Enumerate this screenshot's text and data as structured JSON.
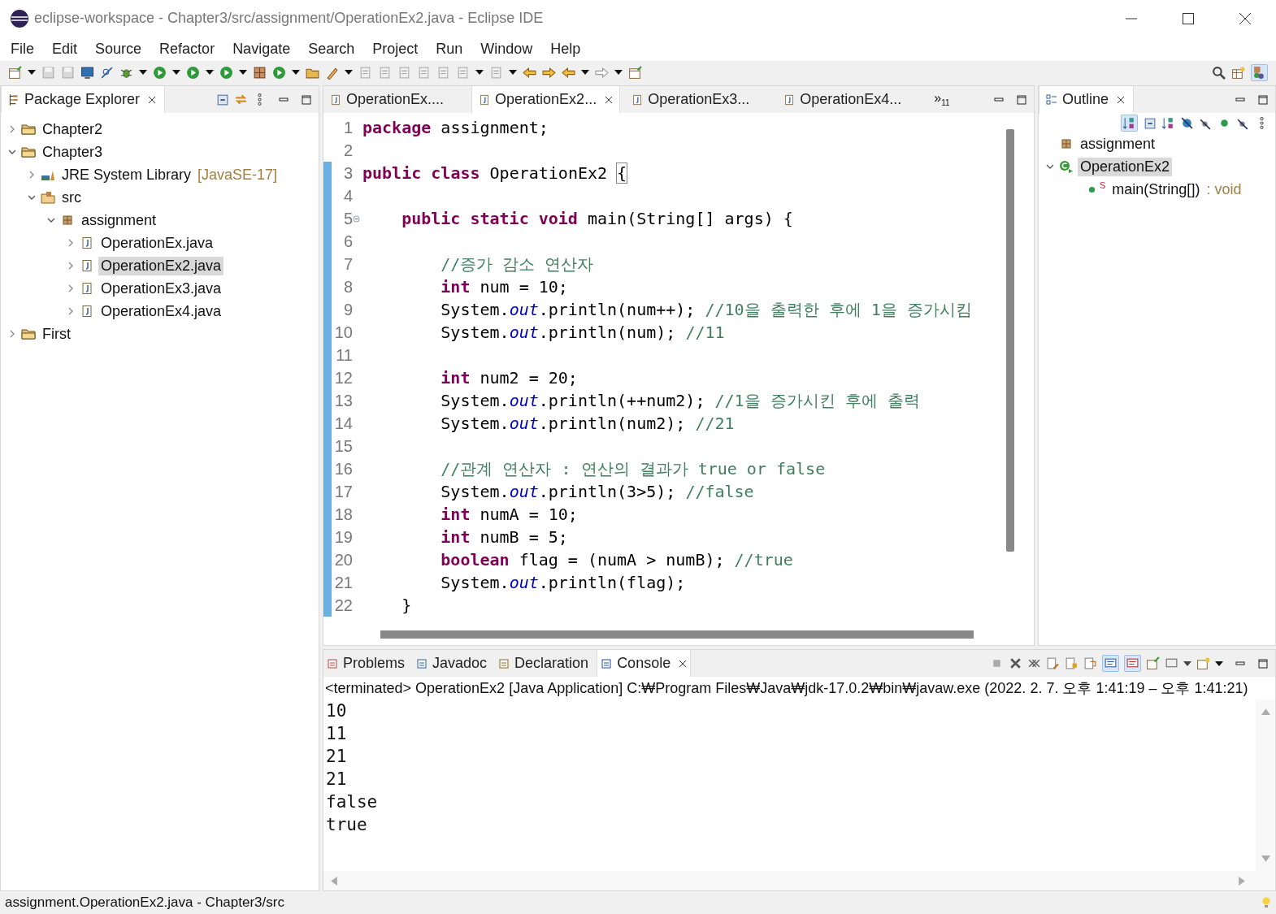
{
  "window": {
    "title": "eclipse-workspace - Chapter3/src/assignment/OperationEx2.java - Eclipse IDE"
  },
  "menu": [
    "File",
    "Edit",
    "Source",
    "Refactor",
    "Navigate",
    "Search",
    "Project",
    "Run",
    "Window",
    "Help"
  ],
  "explorer": {
    "title": "Package Explorer",
    "tree": [
      {
        "label": "Chapter2",
        "kind": "project",
        "expanded": false,
        "selected": false
      },
      {
        "label": "Chapter3",
        "kind": "project",
        "expanded": true,
        "selected": false,
        "children": [
          {
            "label": "JRE System Library",
            "suffix": "[JavaSE-17]",
            "kind": "library",
            "expanded": false,
            "selected": false
          },
          {
            "label": "src",
            "kind": "folder",
            "expanded": true,
            "selected": false,
            "children": [
              {
                "label": "assignment",
                "kind": "package",
                "expanded": true,
                "selected": false,
                "children": [
                  {
                    "label": "OperationEx.java",
                    "kind": "file",
                    "expanded": false,
                    "selected": false
                  },
                  {
                    "label": "OperationEx2.java",
                    "kind": "file",
                    "expanded": false,
                    "selected": true
                  },
                  {
                    "label": "OperationEx3.java",
                    "kind": "file",
                    "expanded": false,
                    "selected": false
                  },
                  {
                    "label": "OperationEx4.java",
                    "kind": "file",
                    "expanded": false,
                    "selected": false
                  }
                ]
              }
            ]
          }
        ]
      },
      {
        "label": "First",
        "kind": "project",
        "expanded": false,
        "selected": false
      }
    ]
  },
  "editor": {
    "tabs": [
      {
        "label": "OperationEx....",
        "selected": false
      },
      {
        "label": "OperationEx2...",
        "selected": true
      },
      {
        "label": "OperationEx3...",
        "selected": false
      },
      {
        "label": "OperationEx4...",
        "selected": false
      }
    ],
    "overflow": {
      "mark": "»",
      "count": "11"
    },
    "lines": [
      {
        "number": "1",
        "changed": false,
        "tokens": [
          {
            "kind": "kw",
            "s": "package"
          },
          {
            "kind": "text",
            "s": " assignment;"
          }
        ]
      },
      {
        "number": "2",
        "changed": false
      },
      {
        "number": "3",
        "changed": true,
        "tokens": [
          {
            "kind": "kw",
            "s": "public "
          },
          {
            "kind": "kw",
            "s": "class"
          },
          {
            "kind": "text",
            "s": " OperationEx2 "
          },
          {
            "kind": "bracket",
            "s": "{"
          }
        ]
      },
      {
        "number": "4",
        "changed": true
      },
      {
        "number": "5",
        "changed": true,
        "expanded": true,
        "tokens": [
          {
            "kind": "kw",
            "s": "    public "
          },
          {
            "kind": "kw",
            "s": "static "
          },
          {
            "kind": "kw",
            "s": "void"
          },
          {
            "kind": "text",
            "s": " main(String[] args) {"
          }
        ]
      },
      {
        "number": "6",
        "changed": true
      },
      {
        "number": "7",
        "changed": true,
        "tokens": [
          {
            "kind": "comment",
            "s": "        //증가 감소 연산자"
          }
        ]
      },
      {
        "number": "8",
        "changed": true,
        "tokens": [
          {
            "kind": "kw",
            "s": "        int"
          },
          {
            "kind": "text",
            "s": " num = 10;"
          }
        ]
      },
      {
        "number": "9",
        "changed": true,
        "tokens": [
          {
            "kind": "text",
            "s": "        System."
          },
          {
            "kind": "field",
            "s": "out"
          },
          {
            "kind": "text",
            "s": ".println(num++); "
          },
          {
            "kind": "comment",
            "s": "//10을 출력한 후에 1을 증가시킴"
          }
        ]
      },
      {
        "number": "10",
        "changed": true,
        "tokens": [
          {
            "kind": "text",
            "s": "        System."
          },
          {
            "kind": "field",
            "s": "out"
          },
          {
            "kind": "text",
            "s": ".println(num); "
          },
          {
            "kind": "comment",
            "s": "//11"
          }
        ]
      },
      {
        "number": "11",
        "changed": true
      },
      {
        "number": "12",
        "changed": true,
        "tokens": [
          {
            "kind": "kw",
            "s": "        int"
          },
          {
            "kind": "text",
            "s": " num2 = 20;"
          }
        ]
      },
      {
        "number": "13",
        "changed": true,
        "tokens": [
          {
            "kind": "text",
            "s": "        System."
          },
          {
            "kind": "field",
            "s": "out"
          },
          {
            "kind": "text",
            "s": ".println(++num2); "
          },
          {
            "kind": "comment",
            "s": "//1을 증가시킨 후에 출력"
          }
        ]
      },
      {
        "number": "14",
        "changed": true,
        "tokens": [
          {
            "kind": "text",
            "s": "        System."
          },
          {
            "kind": "field",
            "s": "out"
          },
          {
            "kind": "text",
            "s": ".println(num2); "
          },
          {
            "kind": "comment",
            "s": "//21"
          }
        ]
      },
      {
        "number": "15",
        "changed": true
      },
      {
        "number": "16",
        "changed": true,
        "tokens": [
          {
            "kind": "comment",
            "s": "        //관계 연산자 : 연산의 결과가 true or false"
          }
        ]
      },
      {
        "number": "17",
        "changed": true,
        "tokens": [
          {
            "kind": "text",
            "s": "        System."
          },
          {
            "kind": "field",
            "s": "out"
          },
          {
            "kind": "text",
            "s": ".println(3>5); "
          },
          {
            "kind": "comment",
            "s": "//false"
          }
        ]
      },
      {
        "number": "18",
        "changed": true,
        "tokens": [
          {
            "kind": "kw",
            "s": "        int"
          },
          {
            "kind": "text",
            "s": " numA = 10;"
          }
        ]
      },
      {
        "number": "19",
        "changed": true,
        "tokens": [
          {
            "kind": "kw",
            "s": "        int"
          },
          {
            "kind": "text",
            "s": " numB = 5;"
          }
        ]
      },
      {
        "number": "20",
        "changed": true,
        "tokens": [
          {
            "kind": "kw",
            "s": "        boolean"
          },
          {
            "kind": "text",
            "s": " flag = (numA > numB); "
          },
          {
            "kind": "comment",
            "s": "//true"
          }
        ]
      },
      {
        "number": "21",
        "changed": true,
        "tokens": [
          {
            "kind": "text",
            "s": "        System."
          },
          {
            "kind": "field",
            "s": "out"
          },
          {
            "kind": "text",
            "s": ".println(flag);"
          }
        ]
      },
      {
        "number": "22",
        "changed": true,
        "tokens": [
          {
            "kind": "text",
            "s": "    }"
          }
        ]
      }
    ]
  },
  "outline": {
    "title": "Outline",
    "tree": [
      {
        "label": "assignment",
        "kind": "package",
        "selected": false
      },
      {
        "label": "OperationEx2",
        "kind": "class",
        "expanded": true,
        "selected": true,
        "children": [
          {
            "label": "main(String[])",
            "suffix": ": void",
            "badge": "S",
            "kind": "method",
            "selected": false
          }
        ]
      }
    ]
  },
  "bottom_tabs": [
    {
      "label": "Problems",
      "kind": "problems",
      "selected": false
    },
    {
      "label": "Javadoc",
      "kind": "javadoc",
      "selected": false
    },
    {
      "label": "Declaration",
      "kind": "declaration",
      "selected": false
    },
    {
      "label": "Console",
      "kind": "console",
      "selected": true
    }
  ],
  "console": {
    "header": "<terminated> OperationEx2 [Java Application] C:₩Program Files₩Java₩jdk-17.0.2₩bin₩javaw.exe  (2022. 2. 7. 오후 1:41:19 – 오후 1:41:21)",
    "lines": [
      "10",
      "11",
      "21",
      "21",
      "false",
      "true"
    ]
  },
  "status_bar": "assignment.OperationEx2.java - Chapter3/src"
}
